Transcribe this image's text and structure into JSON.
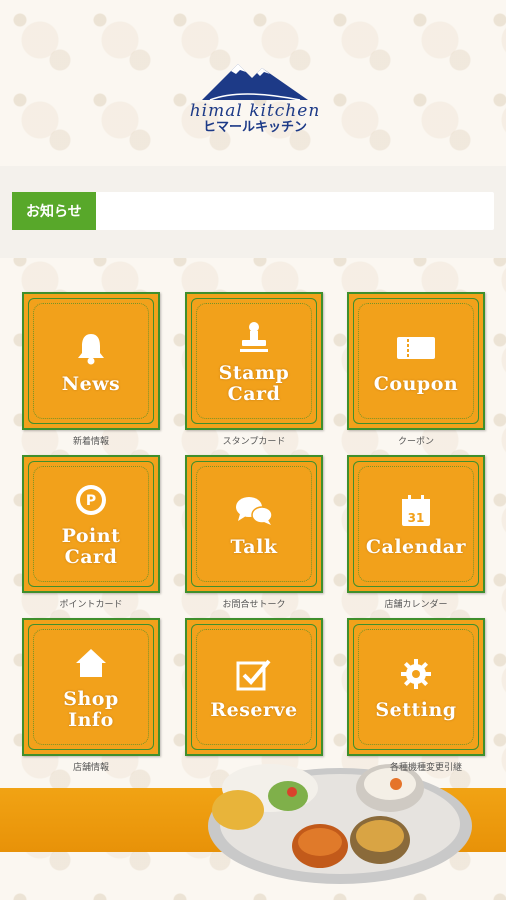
{
  "header": {
    "logo_en": "himal kitchen",
    "logo_jp": "ヒマールキッチン"
  },
  "news": {
    "tag": "お知らせ",
    "text": ""
  },
  "tiles": [
    {
      "label": "News",
      "caption": "新着情報",
      "icon": "bell-icon"
    },
    {
      "label": "Stamp\nCard",
      "caption": "スタンプカード",
      "icon": "stamp-icon"
    },
    {
      "label": "Coupon",
      "caption": "クーポン",
      "icon": "ticket-icon"
    },
    {
      "label": "Point\nCard",
      "caption": "ポイントカード",
      "icon": "point-coin-icon"
    },
    {
      "label": "Talk",
      "caption": "お問合せトーク",
      "icon": "chat-bubbles-icon"
    },
    {
      "label": "Calendar",
      "caption": "店舗カレンダー",
      "icon": "calendar-icon",
      "calendar_day": "31"
    },
    {
      "label": "Shop\nInfo",
      "caption": "店舗情報",
      "icon": "home-icon"
    },
    {
      "label": "Reserve",
      "caption": "",
      "icon": "checkbox-icon"
    },
    {
      "label": "Setting",
      "caption": "各種機種変更引継",
      "icon": "gear-icon"
    }
  ],
  "colors": {
    "tile_bg": "#f2a11b",
    "tile_border": "#3f8f2c",
    "news_tag": "#58a82a",
    "logo": "#1d3a87",
    "band": "#f1a314"
  }
}
